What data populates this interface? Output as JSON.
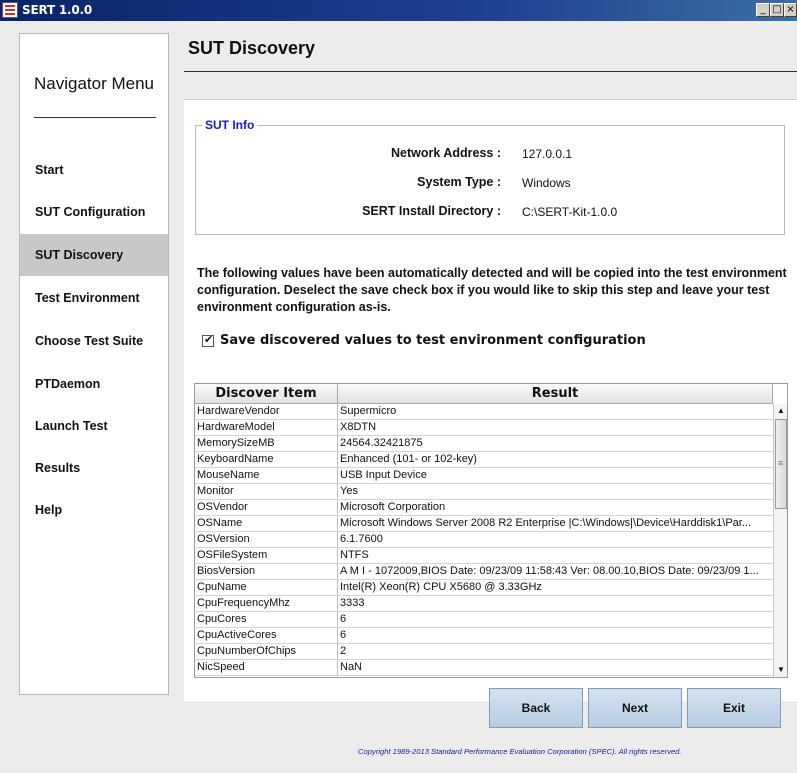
{
  "window": {
    "title": "SERT 1.0.0",
    "controls": [
      "_",
      "□",
      "×"
    ]
  },
  "nav": {
    "title": "Navigator Menu",
    "items": [
      {
        "label": "Start",
        "active": false
      },
      {
        "label": "SUT Configuration",
        "active": false
      },
      {
        "label": "SUT Discovery",
        "active": true
      },
      {
        "label": "Test Environment",
        "active": false
      },
      {
        "label": "Choose Test Suite",
        "active": false
      },
      {
        "label": "PTDaemon",
        "active": false
      },
      {
        "label": "Launch Test",
        "active": false
      },
      {
        "label": "Results",
        "active": false
      },
      {
        "label": "Help",
        "active": false
      }
    ]
  },
  "page": {
    "title": "SUT Discovery"
  },
  "sut_info": {
    "legend": "SUT Info",
    "rows": [
      {
        "label": "Network Address :",
        "value": "127.0.0.1"
      },
      {
        "label": "System Type :",
        "value": "Windows"
      },
      {
        "label": "SERT Install Directory :",
        "value": "C:\\SERT-Kit-1.0.0"
      }
    ]
  },
  "description": "The following values have been automatically detected and will be copied into the test environment configuration. Deselect the save check box if you would like to skip this step and leave your test environment configuration as-is.",
  "save_option": {
    "label": "Save discovered values to test environment configuration",
    "checked": true
  },
  "table": {
    "columns": [
      "Discover Item",
      "Result"
    ],
    "rows": [
      [
        "HardwareVendor",
        "Supermicro"
      ],
      [
        "HardwareModel",
        "X8DTN"
      ],
      [
        "MemorySizeMB",
        "24564.32421875"
      ],
      [
        "KeyboardName",
        "Enhanced (101- or 102-key)"
      ],
      [
        "MouseName",
        "USB Input Device"
      ],
      [
        "Monitor",
        "Yes"
      ],
      [
        "OSVendor",
        "Microsoft Corporation"
      ],
      [
        "OSName",
        "Microsoft Windows Server 2008 R2 Enterprise |C:\\Windows|\\Device\\Harddisk1\\Par..."
      ],
      [
        "OSVersion",
        "6.1.7600"
      ],
      [
        "OSFileSystem",
        "NTFS"
      ],
      [
        "BiosVersion",
        "A M I - 1072009,BIOS Date: 09/23/09 11:58:43 Ver: 08.00.10,BIOS Date: 09/23/09 1..."
      ],
      [
        "CpuName",
        "Intel(R) Xeon(R) CPU        X5680  @ 3.33GHz"
      ],
      [
        "CpuFrequencyMhz",
        "3333"
      ],
      [
        "CpuCores",
        "6"
      ],
      [
        "CpuActiveCores",
        "6"
      ],
      [
        "CpuNumberOfChips",
        "2"
      ],
      [
        "NicSpeed",
        "NaN"
      ]
    ]
  },
  "buttons": {
    "back": "Back",
    "next": "Next",
    "exit": "Exit"
  },
  "footer": {
    "copyright": "Copyright 1989-2013 Standard Performance Evaluation Corporation (SPEC). All rights reserved."
  }
}
